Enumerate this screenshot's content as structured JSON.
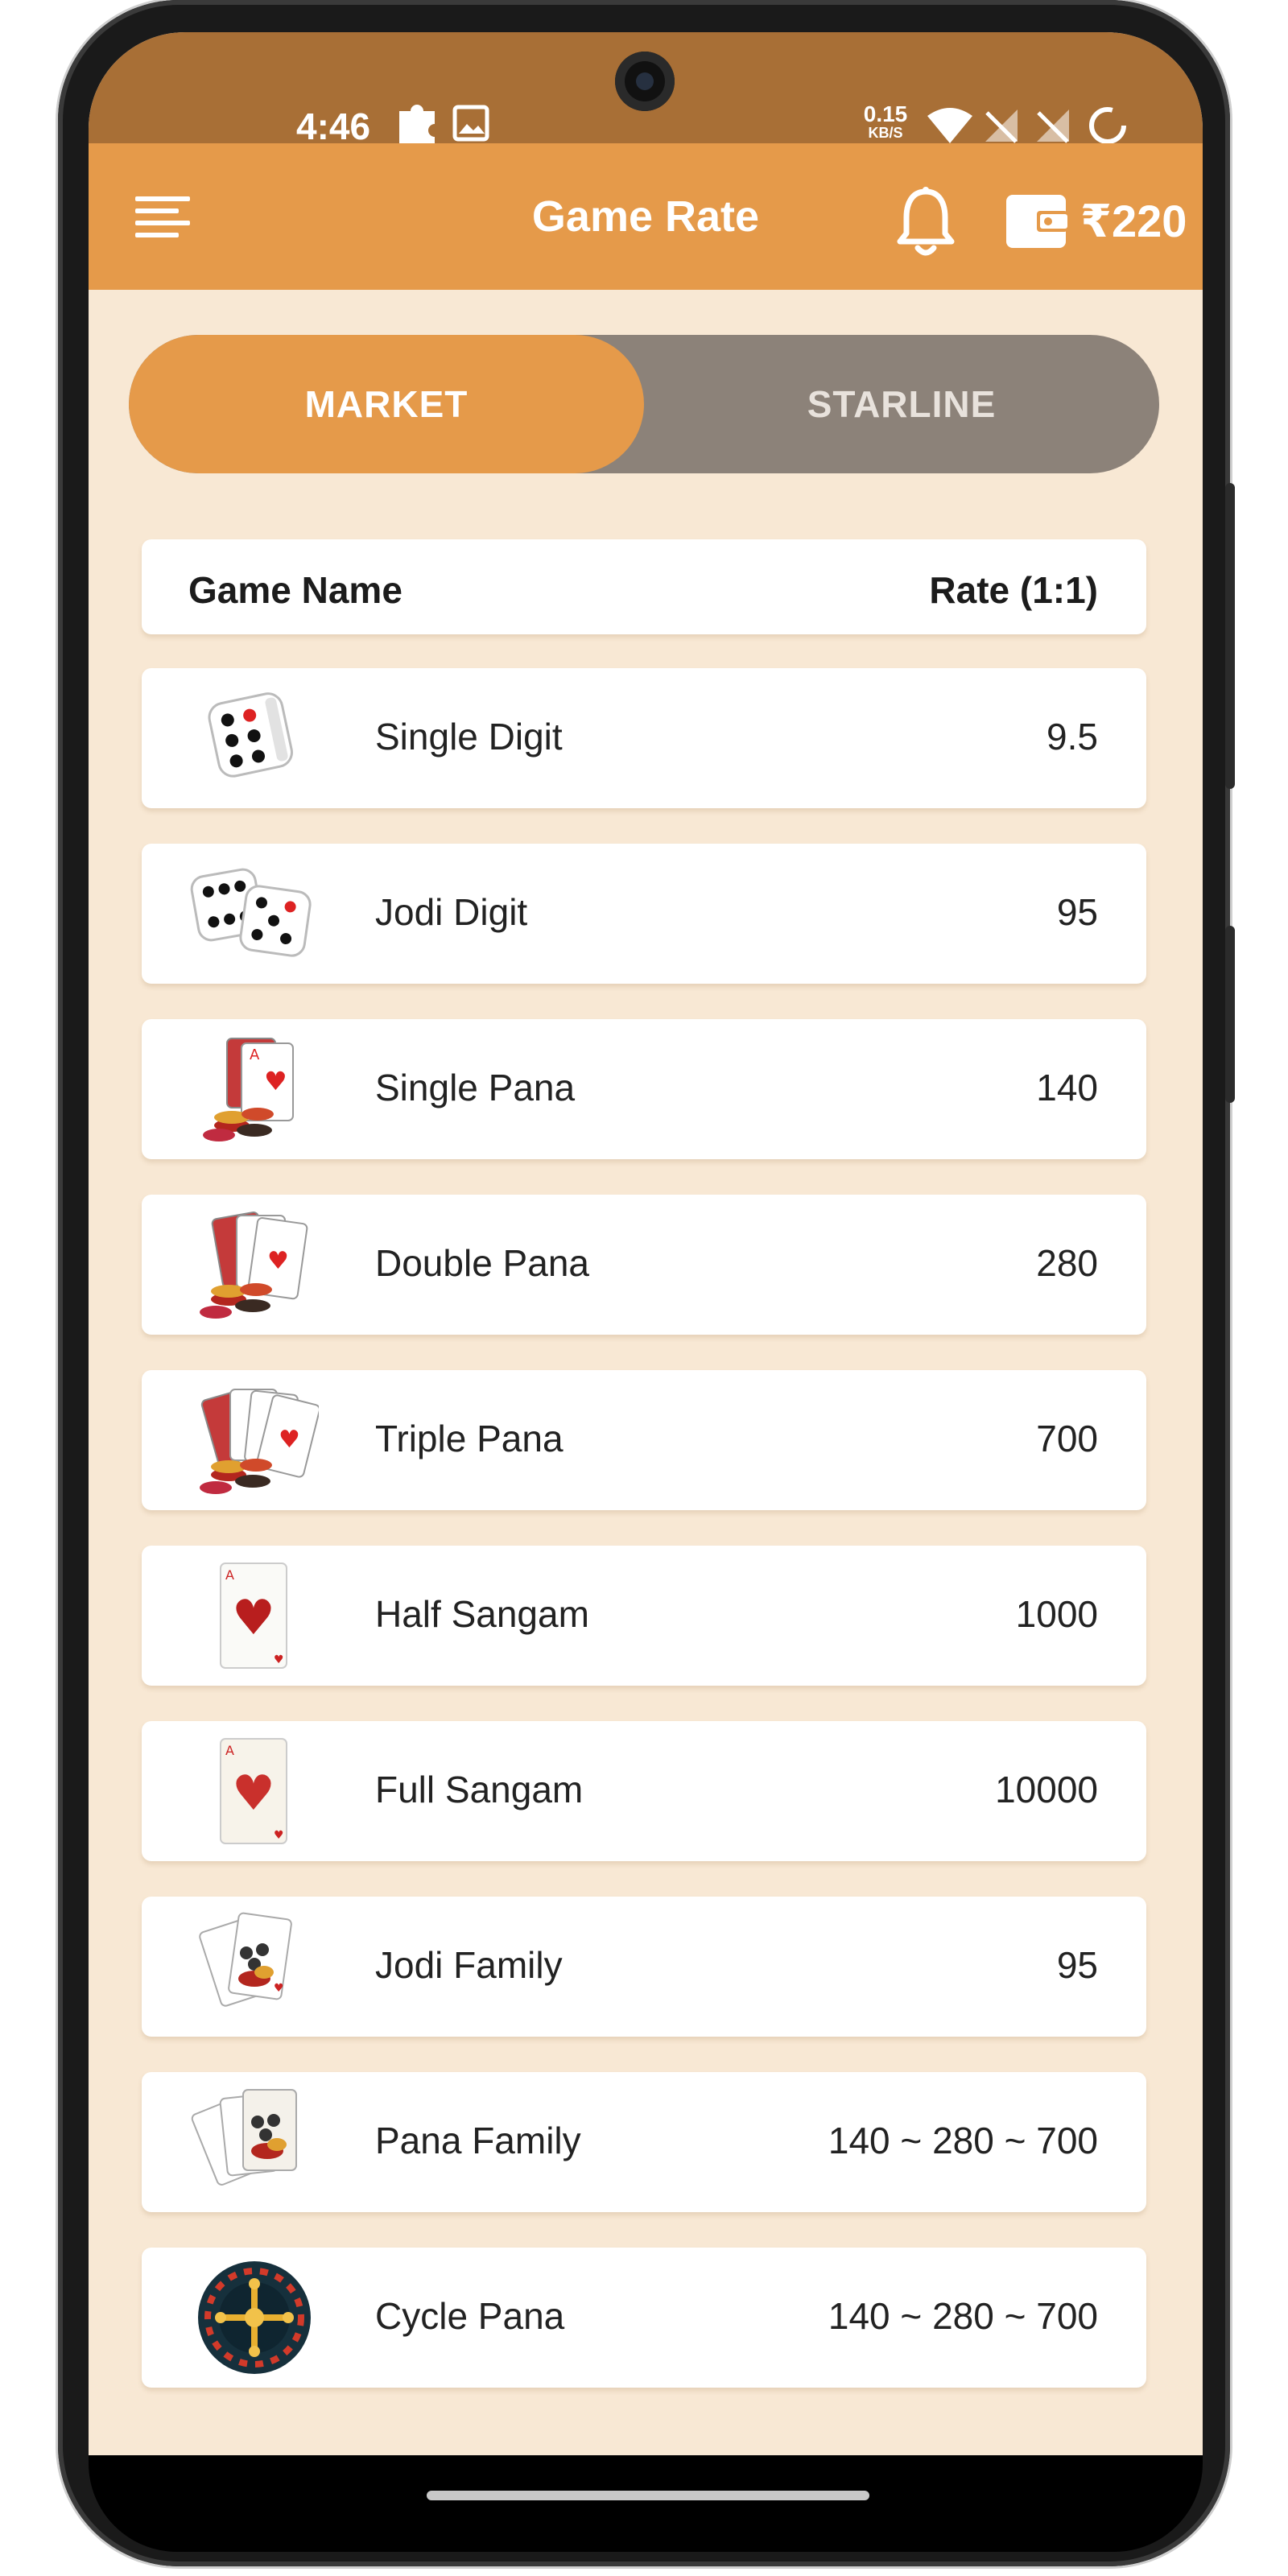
{
  "status_bar": {
    "time": "4:46",
    "net_speed": "0.15",
    "net_unit": "KB/S"
  },
  "app_bar": {
    "title": "Game Rate",
    "wallet_amount": "₹220",
    "accent_color": "#e59a4a"
  },
  "tabs": {
    "market_label": "MARKET",
    "starline_label": "STARLINE",
    "active": "MARKET"
  },
  "table": {
    "header_name": "Game Name",
    "header_rate": "Rate (1:1)",
    "rows": [
      {
        "name": "Single Digit",
        "rate": "9.5",
        "icon": "single-dice-icon"
      },
      {
        "name": "Jodi Digit",
        "rate": "95",
        "icon": "double-dice-icon"
      },
      {
        "name": "Single Pana",
        "rate": "140",
        "icon": "cards-chips-icon"
      },
      {
        "name": "Double Pana",
        "rate": "280",
        "icon": "cards-chips-icon"
      },
      {
        "name": "Triple Pana",
        "rate": "700",
        "icon": "cards-chips-icon"
      },
      {
        "name": "Half Sangam",
        "rate": "1000",
        "icon": "heart-card-icon"
      },
      {
        "name": "Full Sangam",
        "rate": "10000",
        "icon": "heart-card-icon"
      },
      {
        "name": "Jodi Family",
        "rate": "95",
        "icon": "family-cards-icon"
      },
      {
        "name": "Pana Family",
        "rate": "140 ~ 280 ~ 700",
        "icon": "family-cards-icon"
      },
      {
        "name": "Cycle Pana",
        "rate": "140 ~ 280 ~ 700",
        "icon": "roulette-wheel-icon"
      }
    ]
  }
}
